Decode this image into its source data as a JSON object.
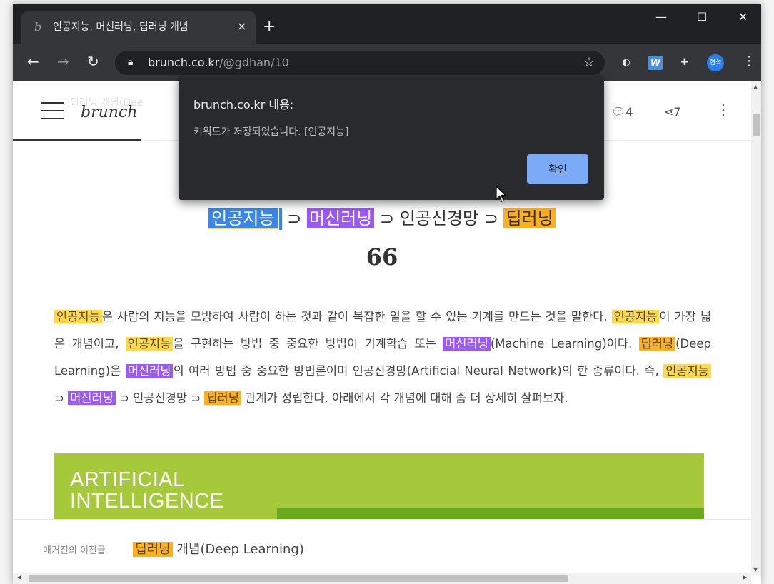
{
  "browser": {
    "tab_title": "인공지능, 머신러닝, 딥러닝 개념",
    "tab_close": "×",
    "new_tab": "+",
    "window_controls": {
      "minimize": "—",
      "maximize": "☐",
      "close": "✕"
    },
    "url_host": "brunch.co.kr",
    "url_path": "/@gdhan/10",
    "profile_label": "현석",
    "icons": [
      "back-icon",
      "forward-icon",
      "reload-icon",
      "lock-icon",
      "star-icon",
      "dark-mode-extension-icon",
      "w-extension-icon",
      "puzzle-extensions-icon",
      "profile-avatar",
      "menu-dots-icon"
    ]
  },
  "site": {
    "brand": "brunch",
    "header_ghost": "딥러닝 개념(Dee",
    "comments_count": "4",
    "shares_count": "7"
  },
  "article": {
    "heading": {
      "t1": "인공지능",
      "t2": "⊃",
      "t3": "머신러닝",
      "t4": "⊃ 인공신경망 ⊃",
      "t5": "딥러닝"
    },
    "quote_mark": "66",
    "paragraph": {
      "s1": "인공지능",
      "s2": "은 사람의 지능을 모방하여 사람이 하는 것과 같이 복잡한 일을 할 수 있는 기계를 만드는 것을 말한다. ",
      "s3": "인공지능",
      "s4": "이 가장 넓은 개념이고, ",
      "s5": "인공지능",
      "s6": "을 구현하는 방법 중 중요한 방법이 기계학습 또는 ",
      "s7": "머신러닝",
      "s8": "(Machine Learning)이다. ",
      "s9": "딥러닝",
      "s10": "(Deep Learning)은 ",
      "s11": "머신러닝",
      "s12": "의 여러 방법 중 중요한 방법론이며 인공신경망(Artificial Neural Network)의 한 종류이다. 즉, ",
      "s13": "인공지능",
      "s14": " ⊃ ",
      "s15": "머신러닝",
      "s16": " ⊃ 인공신경망 ⊃ ",
      "s17": "딥러닝",
      "s18": " 관계가 성립한다. 아래에서 각 개념에 대해 좀 더 상세히 살펴보자."
    },
    "image_title_line1": "ARTIFICIAL",
    "image_title_line2": "INTELLIGENCE"
  },
  "footer": {
    "label": "매거진의 이전글",
    "highlight": "딥러닝",
    "title_rest": " 개념(Deep Learning)"
  },
  "dialog": {
    "title": "brunch.co.kr 내용:",
    "message": "키워드가 저장되었습니다. [인공지능]",
    "ok_label": "확인"
  },
  "colors": {
    "highlight_yellow": "#ffd94a",
    "highlight_purple": "#9b59f5",
    "highlight_orange": "#ffb01e",
    "selection_blue": "#3a86e8",
    "dialog_button": "#7baaf7",
    "ai_image_green": "#a6c93c"
  }
}
